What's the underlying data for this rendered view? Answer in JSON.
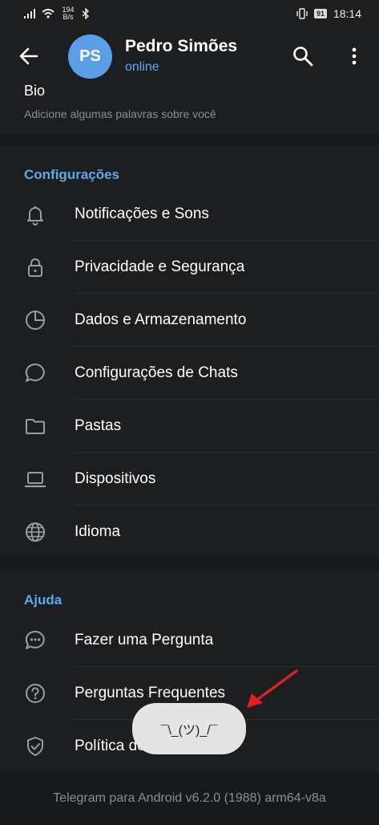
{
  "status_bar": {
    "network_speed_value": "194",
    "network_speed_unit": "B/s",
    "battery": "91",
    "time": "18:14"
  },
  "header": {
    "avatar_initials": "PS",
    "name": "Pedro Simões",
    "status": "online"
  },
  "bio": {
    "title": "Bio",
    "subtitle": "Adicione algumas palavras sobre você"
  },
  "settings": {
    "header": "Configurações",
    "items": [
      {
        "label": "Notificações e Sons",
        "icon": "bell-icon"
      },
      {
        "label": "Privacidade e Segurança",
        "icon": "lock-icon"
      },
      {
        "label": "Dados e Armazenamento",
        "icon": "pie-chart-icon"
      },
      {
        "label": "Configurações de Chats",
        "icon": "chat-bubble-icon"
      },
      {
        "label": "Pastas",
        "icon": "folder-icon"
      },
      {
        "label": "Dispositivos",
        "icon": "laptop-icon"
      },
      {
        "label": "Idioma",
        "icon": "globe-icon"
      }
    ]
  },
  "help": {
    "header": "Ajuda",
    "items": [
      {
        "label": "Fazer uma Pergunta",
        "icon": "chat-dots-icon"
      },
      {
        "label": "Perguntas Frequentes",
        "icon": "question-icon"
      },
      {
        "label": "Política de Privacidade",
        "icon": "shield-check-icon"
      }
    ]
  },
  "footer": {
    "version": "Telegram para Android v6.2.0 (1988) arm64-v8a"
  },
  "toast": {
    "text": "¯\\_(ツ)_/¯"
  },
  "colors": {
    "accent": "#5ea8ec",
    "avatar": "#5a9ee7",
    "background": "#18191b",
    "surface": "#1d1e20",
    "annotation_arrow": "#e02020"
  }
}
